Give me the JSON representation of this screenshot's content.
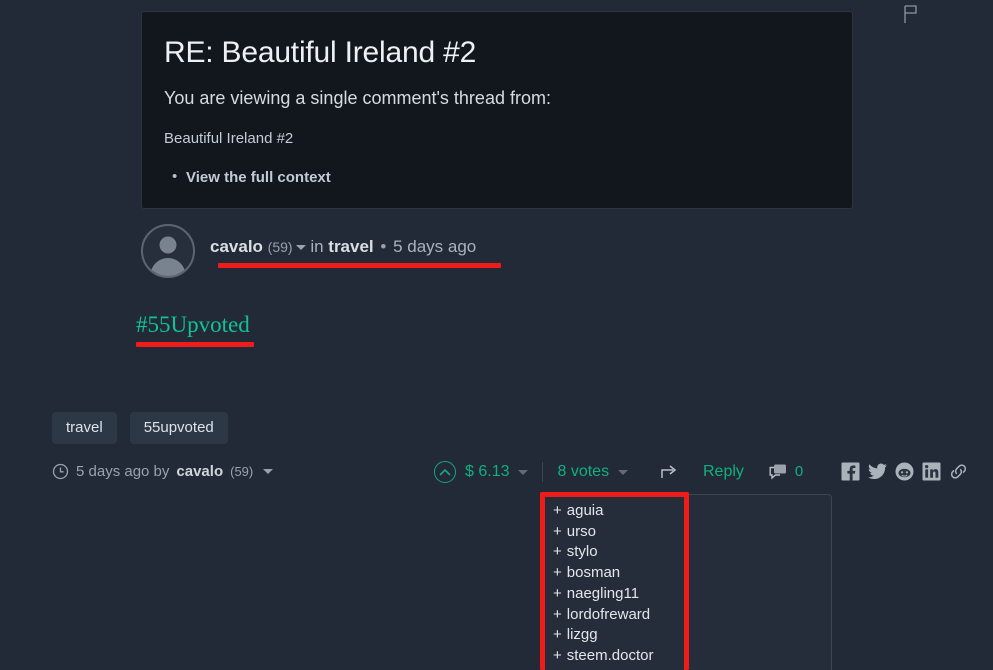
{
  "page": {
    "background_color": "#212a36",
    "accent_green": "#11b07f",
    "annotation_color": "#ef1c1c"
  },
  "topbar": {
    "flag_icon": "flag-icon"
  },
  "context_card": {
    "title": "RE: Beautiful Ireland #2",
    "subtitle": "You are viewing a single comment's thread from:",
    "parent_post": "Beautiful Ireland #2",
    "links": [
      {
        "label": "View the full context"
      }
    ]
  },
  "author": {
    "avatar_icon": "user-avatar-icon",
    "name": "cavalo",
    "reputation": "(59)",
    "in_word": "in",
    "category": "travel",
    "separator": "•",
    "time_ago": "5 days ago",
    "caret_icon": "chevron-down-icon"
  },
  "body": {
    "hashtag": "#55Upvoted"
  },
  "tags": [
    {
      "label": "travel"
    },
    {
      "label": "55upvoted"
    }
  ],
  "footer": {
    "clock_icon": "clock-icon",
    "time_by_prefix": "5 days ago by",
    "author_name": "cavalo",
    "author_rep": "(59)",
    "upvote_icon": "upvote-arrow-icon",
    "payout": "$ 6.13",
    "votes_label": "8 votes",
    "share_icon": "share-arrow-icon",
    "reply_label": "Reply",
    "comment_icon": "comment-bubble-icon",
    "comment_count": "0",
    "social": [
      {
        "name": "facebook-icon"
      },
      {
        "name": "twitter-icon"
      },
      {
        "name": "reddit-icon"
      },
      {
        "name": "linkedin-icon"
      },
      {
        "name": "link-icon"
      }
    ]
  },
  "voters_dropdown": {
    "voters": [
      {
        "prefix": "+",
        "name": "aguia"
      },
      {
        "prefix": "+",
        "name": "urso"
      },
      {
        "prefix": "+",
        "name": "stylo"
      },
      {
        "prefix": "+",
        "name": "bosman"
      },
      {
        "prefix": "+",
        "name": "naegling11"
      },
      {
        "prefix": "+",
        "name": "lordofreward"
      },
      {
        "prefix": "+",
        "name": "lizgg"
      },
      {
        "prefix": "+",
        "name": "steem.doctor"
      }
    ]
  }
}
